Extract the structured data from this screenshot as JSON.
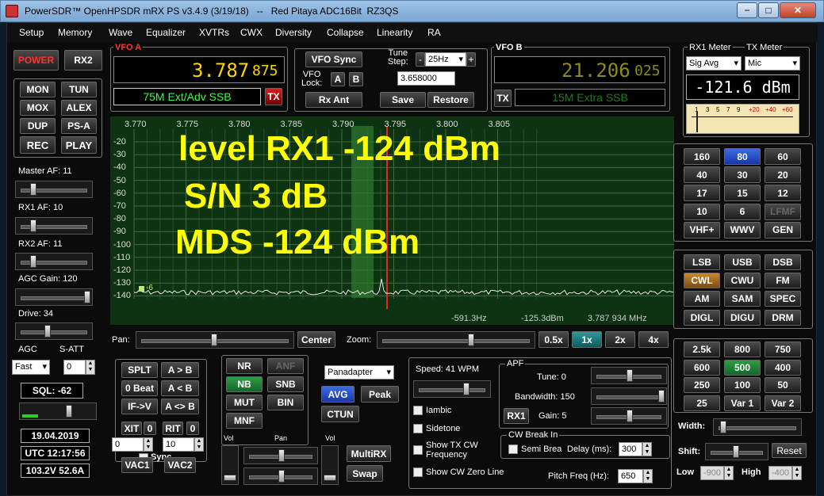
{
  "window": {
    "title": "PowerSDR™ OpenHPSDR mRX PS v3.4.9 (3/19/18)   --   Red Pitaya ADC16Bit  RZ3QS",
    "minimize": "−",
    "maximize": "□",
    "close": "✕"
  },
  "menu": [
    "Setup",
    "Memory",
    "Wave",
    "Equalizer",
    "XVTRs",
    "CWX",
    "Diversity",
    "Collapse",
    "Linearity",
    "RA"
  ],
  "left": {
    "power": "POWER",
    "rx2": "RX2",
    "mon": "MON",
    "tun": "TUN",
    "mox": "MOX",
    "alex": "ALEX",
    "dup": "DUP",
    "psa": "PS-A",
    "rec": "REC",
    "play": "PLAY",
    "master_af": "Master AF:  11",
    "rx1_af": "RX1 AF:  10",
    "rx2_af": "RX2 AF:  11",
    "agc_gain": "AGC Gain:  120",
    "drive": "Drive:  34",
    "agc": "AGC",
    "satt": "S-ATT",
    "agc_mode": "Fast",
    "satt_val": "0",
    "sql": "SQL:  -62",
    "date": "19.04.2019",
    "utc": "UTC 12:17:56",
    "power_stat": "103.2V  52.6A"
  },
  "vfoa": {
    "label": "VFO A",
    "freq_main": "3.787",
    "freq_sub": "875",
    "band": "75M Ext/Adv SSB",
    "tx": "TX"
  },
  "vfo_center": {
    "sync": "VFO Sync",
    "tune_step": "Tune\nStep:",
    "step_minus": "-",
    "step_val": "25Hz",
    "step_plus": "+",
    "lock": "VFO\nLock:",
    "a": "A",
    "b": "B",
    "freq_field": "3.658000",
    "rxant": "Rx Ant",
    "save": "Save",
    "restore": "Restore"
  },
  "vfob": {
    "label": "VFO B",
    "freq_main": "21.206",
    "freq_sub": "025",
    "band": "15M Extra SSB",
    "tx": "TX"
  },
  "meter": {
    "rx1": "RX1 Meter",
    "tx": "TX Meter",
    "rx1_mode": "Sig Avg",
    "tx_mode": "Mic",
    "reading": "-121.6 dBm",
    "scale": [
      "1",
      "3",
      "5",
      "7",
      "9",
      "+20",
      "+40",
      "+60"
    ]
  },
  "panadapter": {
    "freqs": [
      "3.770",
      "3.775",
      "3.780",
      "3.785",
      "3.790",
      "3.795",
      "3.800",
      "3.805"
    ],
    "dbs": [
      "-20",
      "-30",
      "-40",
      "-50",
      "-60",
      "-70",
      "-80",
      "-90",
      "-100",
      "-110",
      "-120",
      "-130",
      "-140"
    ],
    "marker": "-6",
    "status1": "-591.3Hz",
    "status2": "-125.3dBm",
    "status3": "3.787 934 MHz",
    "overlay1": "level RX1  -124 dBm",
    "overlay2": "S/N 3 dB",
    "overlay3": "MDS -124 dBm"
  },
  "bands": [
    "160",
    "80",
    "60",
    "40",
    "30",
    "20",
    "17",
    "15",
    "12",
    "10",
    "6",
    "LFMF",
    "VHF+",
    "WWV",
    "GEN"
  ],
  "modes": [
    "LSB",
    "USB",
    "DSB",
    "CWL",
    "CWU",
    "FM",
    "AM",
    "SAM",
    "SPEC",
    "DIGL",
    "DIGU",
    "DRM"
  ],
  "filters": [
    "2.5k",
    "800",
    "750",
    "600",
    "500",
    "400",
    "250",
    "100",
    "50",
    "25",
    "Var 1",
    "Var 2"
  ],
  "right_bottom": {
    "width": "Width:",
    "shift": "Shift:",
    "reset": "Reset",
    "low": "Low",
    "low_val": "-900",
    "high": "High",
    "high_val": "-400"
  },
  "lower": {
    "pan": "Pan:",
    "center": "Center",
    "zoom": "Zoom:",
    "z05": "0.5x",
    "z1": "1x",
    "z2": "2x",
    "z4": "4x",
    "splt": "SPLT",
    "ab": "A > B",
    "zerobeat": "0 Beat",
    "ba": "A < B",
    "ifv": "IF->V",
    "aswap": "A <> B",
    "xit": "XIT",
    "xit_val": "0",
    "rit": "RIT",
    "rit_val": "0",
    "xit_num": "0",
    "rit_num": "10",
    "sync": "Sync",
    "vac1": "VAC1",
    "vac2": "VAC2",
    "nr": "NR",
    "anf": "ANF",
    "nb": "NB",
    "snb": "SNB",
    "mut": "MUT",
    "bin": "BIN",
    "mnf": "MNF",
    "display_mode": "Panadapter",
    "avg": "AVG",
    "peak": "Peak",
    "ctun": "CTUN",
    "vol": "Vol",
    "panlbl": "Pan",
    "vol2": "Vol",
    "multirx": "MultiRX",
    "swap": "Swap",
    "speed": "Speed:  41 WPM",
    "iambic": "Iambic",
    "sidetone": "Sidetone",
    "showtx": "Show TX CW\nFrequency",
    "showzero": "Show CW Zero Line",
    "apf": "APF",
    "tune": "Tune:  0",
    "bandwidth": "Bandwidth:  150",
    "rx1": "RX1",
    "gain": "Gain:  5",
    "breakin": "CW Break In",
    "semi": "Semi Brea",
    "delay": "Delay (ms):",
    "delay_val": "300",
    "pitch": "Pitch Freq (Hz):",
    "pitch_val": "650"
  }
}
